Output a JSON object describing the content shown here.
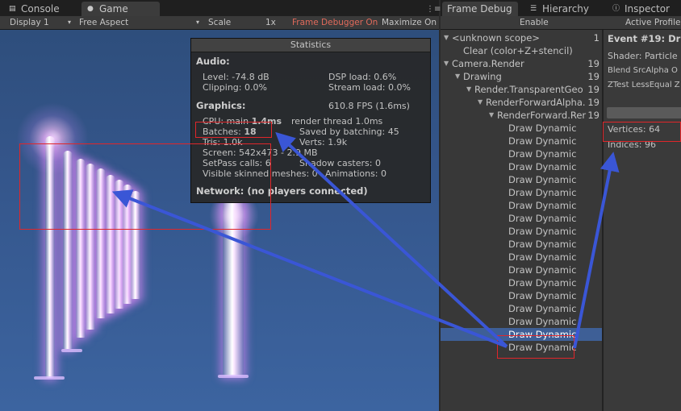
{
  "left_tabs": [
    {
      "label": "Console",
      "icon": "console-icon"
    },
    {
      "label": "Game",
      "icon": "game-icon"
    }
  ],
  "left_toolbar": {
    "display": "Display 1",
    "aspect": "Free Aspect",
    "scale_label": "Scale",
    "scale_value": "1x",
    "frame_debugger": "Frame Debugger On",
    "maximize": "Maximize On"
  },
  "right_tabs": [
    {
      "label": "Frame Debug"
    },
    {
      "label": "Hierarchy",
      "icon": "hierarchy-icon"
    },
    {
      "label": "Inspector",
      "icon": "info-icon"
    }
  ],
  "fd_toolbar": {
    "enable": "Enable",
    "active_profile": "Active Profile"
  },
  "stats": {
    "title": "Statistics",
    "audio_heading": "Audio:",
    "level": "Level: -74.8 dB",
    "dsp": "DSP load: 0.6%",
    "clipping": "Clipping: 0.0%",
    "stream": "Stream load: 0.0%",
    "graphics_heading": "Graphics:",
    "fps": "610.8 FPS (1.6ms)",
    "cpu_prefix": "CPU: main ",
    "cpu_main": "1.4ms",
    "cpu_render": "render thread 1.0ms",
    "batches_prefix": "Batches: ",
    "batches": "18",
    "saved": "Saved by batching: 45",
    "tris": "Tris: 1.0k",
    "verts": "Verts: 1.9k",
    "screen": "Screen: 542x473 - 2.9 MB",
    "setpass": "SetPass calls: 6",
    "shadow": "Shadow casters: 0",
    "skinned": "Visible skinned meshes: 0",
    "animations": "Animations: 0",
    "network": "Network: (no players connected)"
  },
  "tree": [
    {
      "label": "<unknown scope>",
      "count": "1",
      "indent": 0,
      "fold": true
    },
    {
      "label": "Clear (color+Z+stencil)",
      "count": "",
      "indent": 1,
      "fold": false
    },
    {
      "label": "Camera.Render",
      "count": "19",
      "indent": 0,
      "fold": true
    },
    {
      "label": "Drawing",
      "count": "19",
      "indent": 1,
      "fold": true
    },
    {
      "label": "Render.TransparentGeo",
      "count": "19",
      "indent": 2,
      "fold": true
    },
    {
      "label": "RenderForwardAlpha.",
      "count": "19",
      "indent": 3,
      "fold": true
    },
    {
      "label": "RenderForward.Rer",
      "count": "19",
      "indent": 4,
      "fold": true
    },
    {
      "label": "Draw Dynamic",
      "count": "",
      "indent": 5
    },
    {
      "label": "Draw Dynamic",
      "count": "",
      "indent": 5
    },
    {
      "label": "Draw Dynamic",
      "count": "",
      "indent": 5
    },
    {
      "label": "Draw Dynamic",
      "count": "",
      "indent": 5
    },
    {
      "label": "Draw Dynamic",
      "count": "",
      "indent": 5
    },
    {
      "label": "Draw Dynamic",
      "count": "",
      "indent": 5
    },
    {
      "label": "Draw Dynamic",
      "count": "",
      "indent": 5
    },
    {
      "label": "Draw Dynamic",
      "count": "",
      "indent": 5
    },
    {
      "label": "Draw Dynamic",
      "count": "",
      "indent": 5
    },
    {
      "label": "Draw Dynamic",
      "count": "",
      "indent": 5
    },
    {
      "label": "Draw Dynamic",
      "count": "",
      "indent": 5
    },
    {
      "label": "Draw Dynamic",
      "count": "",
      "indent": 5
    },
    {
      "label": "Draw Dynamic",
      "count": "",
      "indent": 5
    },
    {
      "label": "Draw Dynamic",
      "count": "",
      "indent": 5
    },
    {
      "label": "Draw Dynamic",
      "count": "",
      "indent": 5
    },
    {
      "label": "Draw Dynamic",
      "count": "",
      "indent": 5
    },
    {
      "label": "Draw Dynamic",
      "count": "",
      "indent": 5,
      "selected": true
    },
    {
      "label": "Draw Dynamic",
      "count": "",
      "indent": 5
    }
  ],
  "event": {
    "title": "Event #19: Dr",
    "shader": "Shader: Particle",
    "blend": "Blend SrcAlpha O",
    "ztest": "ZTest LessEqual Z",
    "vertices": "Vertices: 64",
    "indices": "Indices: 96"
  },
  "colors": {
    "annotation_box": "#e0262a",
    "annotation_arrow": "#3a56d6",
    "selection": "#3e5f96"
  }
}
